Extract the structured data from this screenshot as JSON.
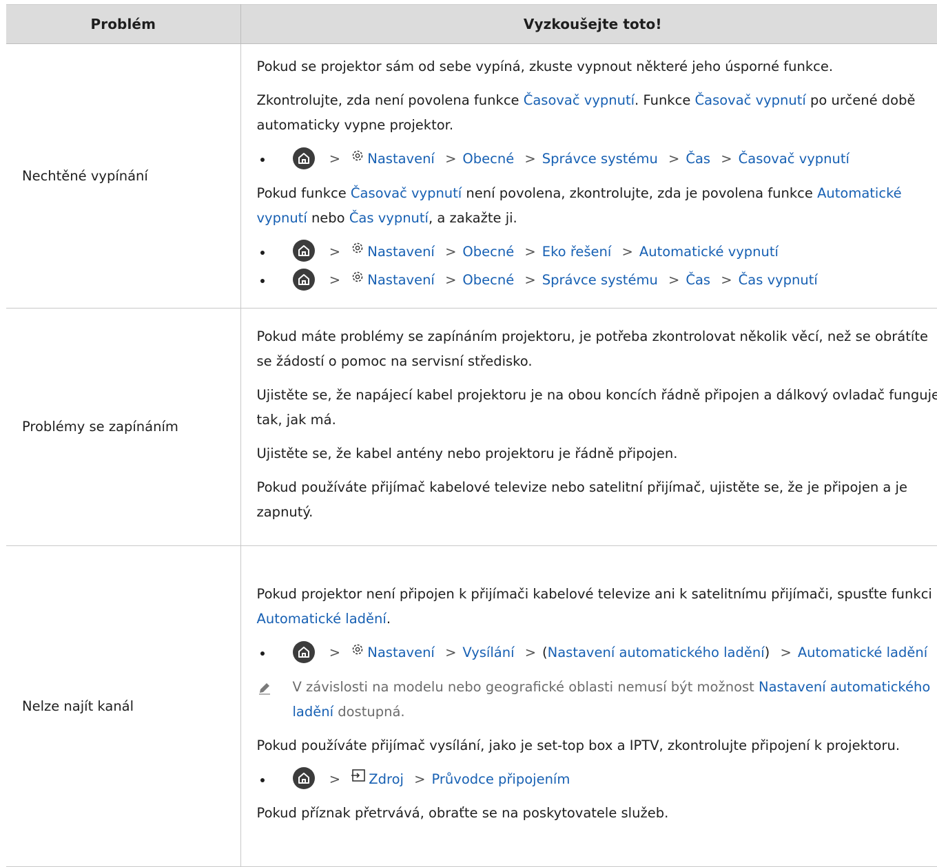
{
  "table": {
    "headers": [
      "Problém",
      "Vyzkoušejte toto!"
    ],
    "row1": {
      "problem": "Nechtěné vypínání",
      "p1": "Pokud se projektor sám od sebe vypíná, zkuste vypnout některé jeho úsporné funkce.",
      "p2a": "Zkontrolujte, zda není povolena funkce ",
      "p2b": "Časovač vypnutí",
      "p2c": ". Funkce ",
      "p2d": "Časovač vypnutí",
      "p2e": " po určené době automaticky vypne projektor.",
      "nav1": [
        "Nastavení",
        "Obecné",
        "Správce systému",
        "Čas",
        "Časovač vypnutí"
      ],
      "p3a": "Pokud funkce ",
      "p3b": "Časovač vypnutí",
      "p3c": " není povolena, zkontrolujte, zda je povolena funkce ",
      "p3d": "Automatické vypnutí",
      "p3e": " nebo ",
      "p3f": "Čas vypnutí",
      "p3g": ", a zakažte ji.",
      "nav2": [
        "Nastavení",
        "Obecné",
        "Eko řešení",
        "Automatické vypnutí"
      ],
      "nav3": [
        "Nastavení",
        "Obecné",
        "Správce systému",
        "Čas",
        "Čas vypnutí"
      ]
    },
    "row2": {
      "problem": "Problémy se zapínáním",
      "p1": "Pokud máte problémy se zapínáním projektoru, je potřeba zkontrolovat několik věcí, než se obrátíte se žádostí o pomoc na servisní středisko.",
      "p2": "Ujistěte se, že napájecí kabel projektoru je na obou koncích řádně připojen a dálkový ovladač funguje tak, jak má.",
      "p3": "Ujistěte se, že kabel antény nebo projektoru je řádně připojen.",
      "p4": "Pokud používáte přijímač kabelové televize nebo satelitní přijímač, ujistěte se, že je připojen a je zapnutý."
    },
    "row3": {
      "problem": "Nelze najít kanál",
      "p1a": "Pokud projektor není připojen k přijímači kabelové televize ani k satelitnímu přijímači, spusťte funkci ",
      "p1b": "Automatické ladění",
      "p1c": ".",
      "nav1": [
        "Nastavení",
        "Vysílání",
        "Nastavení automatického ladění",
        "Automatické ladění"
      ],
      "note_a": "V závislosti na modelu nebo geografické oblasti nemusí být možnost ",
      "note_b": "Nastavení automatického ladění",
      "note_c": " dostupná.",
      "p2": "Pokud používáte přijímač vysílání, jako je set-top box a IPTV, zkontrolujte připojení k projektoru.",
      "nav2": [
        "Zdroj",
        "Průvodce připojením"
      ],
      "p3": "Pokud příznak přetrvává, obraťte se na poskytovatele služeb."
    }
  },
  "icons": {
    "home": "home-icon",
    "settings": "gear-icon",
    "source": "source-icon",
    "note": "pencil-icon",
    "separator": "chevron-right-icon"
  },
  "colors": {
    "link": "#1760b3",
    "header_bg": "#dcdcdc",
    "note_text": "#6b6b6b"
  }
}
